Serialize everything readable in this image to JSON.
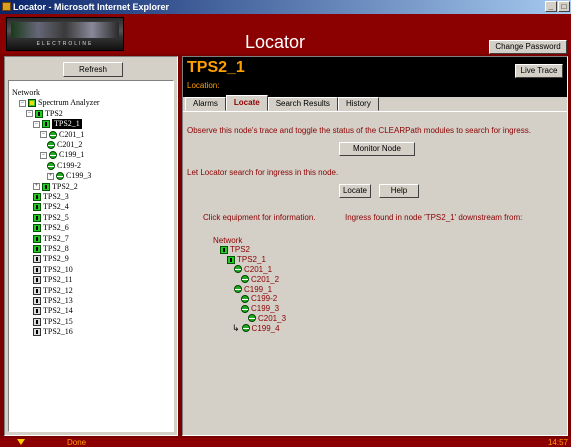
{
  "window": {
    "title": "Locator - Microsoft Internet Explorer",
    "buttons": [
      "_",
      "□"
    ]
  },
  "header": {
    "logo_text": "ELECTROLINE",
    "title": "Locator",
    "change_password": "Change Password"
  },
  "left": {
    "refresh_label": "Refresh",
    "tree": [
      {
        "label": "Network",
        "exp": "",
        "icon": "",
        "indent": 0
      },
      {
        "label": "Spectrum Analyzer",
        "exp": "−",
        "icon": "yel",
        "indent": 1
      },
      {
        "label": "TPS2",
        "exp": "−",
        "icon": "green",
        "indent": 2
      },
      {
        "label": "TPS2_1",
        "exp": "−",
        "icon": "green",
        "indent": 3,
        "selected": true
      },
      {
        "label": "C201_1",
        "exp": "−",
        "icon": "circ",
        "indent": 4
      },
      {
        "label": "C201_2",
        "exp": "",
        "icon": "circ",
        "indent": 5
      },
      {
        "label": "C199_1",
        "exp": "−",
        "icon": "circ",
        "indent": 4
      },
      {
        "label": "C199-2",
        "exp": "",
        "icon": "circ",
        "indent": 5
      },
      {
        "label": "C199_3",
        "exp": "+",
        "icon": "circ",
        "indent": 5
      },
      {
        "label": "TPS2_2",
        "exp": "+",
        "icon": "green",
        "indent": 3
      },
      {
        "label": "TPS2_3",
        "exp": "",
        "icon": "green",
        "indent": 3
      },
      {
        "label": "TPS2_4",
        "exp": "",
        "icon": "green",
        "indent": 3
      },
      {
        "label": "TPS2_5",
        "exp": "",
        "icon": "green",
        "indent": 3
      },
      {
        "label": "TPS2_6",
        "exp": "",
        "icon": "green",
        "indent": 3
      },
      {
        "label": "TPS2_7",
        "exp": "",
        "icon": "green",
        "indent": 3
      },
      {
        "label": "TPS2_8",
        "exp": "",
        "icon": "green",
        "indent": 3
      },
      {
        "label": "TPS2_9",
        "exp": "",
        "icon": "gray",
        "indent": 3
      },
      {
        "label": "TPS2_10",
        "exp": "",
        "icon": "gray",
        "indent": 3
      },
      {
        "label": "TPS2_11",
        "exp": "",
        "icon": "gray",
        "indent": 3
      },
      {
        "label": "TPS2_12",
        "exp": "",
        "icon": "gray",
        "indent": 3
      },
      {
        "label": "TPS2_13",
        "exp": "",
        "icon": "gray",
        "indent": 3
      },
      {
        "label": "TPS2_14",
        "exp": "",
        "icon": "gray",
        "indent": 3
      },
      {
        "label": "TPS2_15",
        "exp": "",
        "icon": "gray",
        "indent": 3
      },
      {
        "label": "TPS2_16",
        "exp": "",
        "icon": "gray",
        "indent": 3
      }
    ]
  },
  "right": {
    "node_name": "TPS2_1",
    "location_label": "Location:",
    "live_trace": "Live Trace",
    "tabs": [
      {
        "label": "Alarms",
        "active": false
      },
      {
        "label": "Locate",
        "active": true
      },
      {
        "label": "Search Results",
        "active": false
      },
      {
        "label": "History",
        "active": false
      }
    ],
    "observe_text": "Observe this node's trace and toggle the status of the CLEARPath modules to search for ingress.",
    "monitor_button": "Monitor Node",
    "let_text": "Let Locator search for ingress in this node.",
    "locate_button": "Locate",
    "help_button": "Help",
    "click_text": "Click equipment for information.",
    "ingress_text": "Ingress found in node 'TPS2_1' downstream from:",
    "trace": [
      {
        "label": "Network",
        "icon": "",
        "indent": 0
      },
      {
        "label": "TPS2",
        "icon": "green",
        "indent": 1
      },
      {
        "label": "TPS2_1",
        "icon": "green",
        "indent": 2
      },
      {
        "label": "C201_1",
        "icon": "circ",
        "indent": 3
      },
      {
        "label": "C201_2",
        "icon": "circ",
        "indent": 4
      },
      {
        "label": "C199_1",
        "icon": "circ",
        "indent": 3
      },
      {
        "label": "C199-2",
        "icon": "circ",
        "indent": 4
      },
      {
        "label": "C199_3",
        "icon": "circ",
        "indent": 4
      },
      {
        "label": "C201_3",
        "icon": "circ",
        "indent": 5
      },
      {
        "label": "C199_4",
        "icon": "circ",
        "indent": 4,
        "arrow": true
      }
    ]
  },
  "status": {
    "text": "Done",
    "time": "14:57"
  }
}
